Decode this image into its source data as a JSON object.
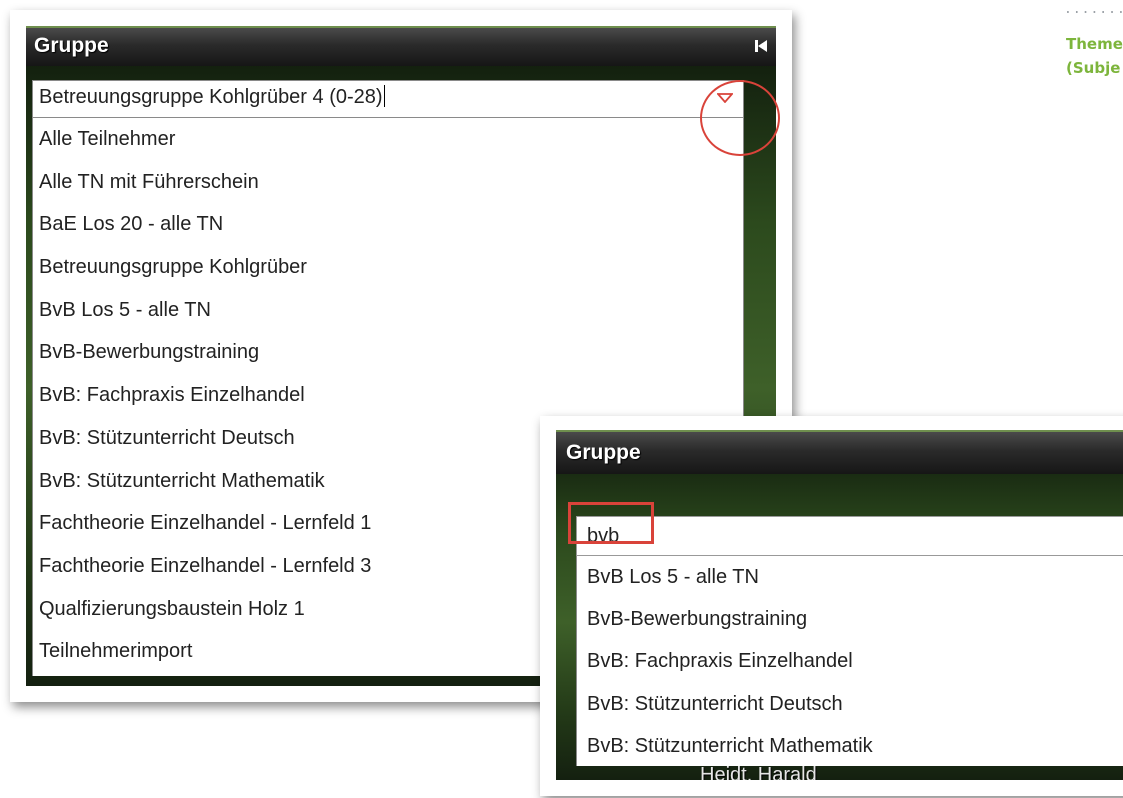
{
  "margin": {
    "dots": "........",
    "note_line1": "Theme",
    "note_line2": "(Subje"
  },
  "left_panel": {
    "title": "Gruppe",
    "combo_value": "Betreuungsgruppe Kohlgrüber 4 (0-28)",
    "options": [
      "Alle Teilnehmer",
      "Alle TN mit Führerschein",
      "BaE Los 20 - alle TN",
      "Betreuungsgruppe Kohlgrüber",
      "BvB Los 5 - alle TN",
      "BvB-Bewerbungstraining",
      "BvB: Fachpraxis Einzelhandel",
      "BvB: Stützunterricht Deutsch",
      "BvB: Stützunterricht Mathematik",
      "Fachtheorie Einzelhandel - Lernfeld 1",
      "Fachtheorie Einzelhandel - Lernfeld 3",
      "Qualfizierungsbaustein Holz 1",
      "Teilnehmerimport"
    ]
  },
  "right_panel": {
    "title": "Gruppe",
    "search_value": "bvb",
    "options": [
      "BvB Los 5 - alle TN",
      "BvB-Bewerbungstraining",
      "BvB: Fachpraxis Einzelhandel",
      "BvB: Stützunterricht Deutsch",
      "BvB: Stützunterricht Mathematik"
    ],
    "footer_text": "Heidt, Harald"
  },
  "colors": {
    "highlight_red": "#d9433a",
    "note_green": "#7db53c"
  }
}
